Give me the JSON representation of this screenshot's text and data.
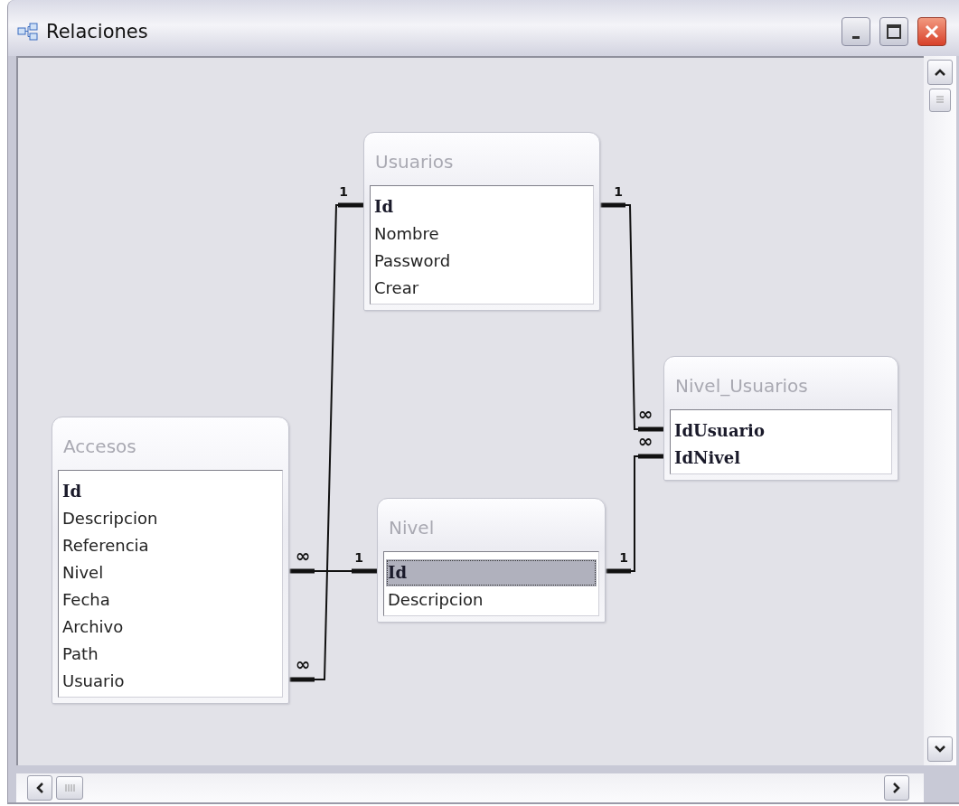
{
  "window": {
    "title": "Relaciones"
  },
  "tables": [
    {
      "name": "Usuarios",
      "fields": [
        {
          "name": "Id",
          "key": true,
          "selected": false
        },
        {
          "name": "Nombre",
          "key": false,
          "selected": false
        },
        {
          "name": "Password",
          "key": false,
          "selected": false
        },
        {
          "name": "Crear",
          "key": false,
          "selected": false
        }
      ]
    },
    {
      "name": "Nivel_Usuarios",
      "fields": [
        {
          "name": "IdUsuario",
          "key": true,
          "selected": false
        },
        {
          "name": "IdNivel",
          "key": true,
          "selected": false
        }
      ]
    },
    {
      "name": "Accesos",
      "fields": [
        {
          "name": "Id",
          "key": true,
          "selected": false
        },
        {
          "name": "Descripcion",
          "key": false,
          "selected": false
        },
        {
          "name": "Referencia",
          "key": false,
          "selected": false
        },
        {
          "name": "Nivel",
          "key": false,
          "selected": false
        },
        {
          "name": "Fecha",
          "key": false,
          "selected": false
        },
        {
          "name": "Archivo",
          "key": false,
          "selected": false
        },
        {
          "name": "Path",
          "key": false,
          "selected": false
        },
        {
          "name": "Usuario",
          "key": false,
          "selected": false
        }
      ]
    },
    {
      "name": "Nivel",
      "fields": [
        {
          "name": "Id",
          "key": true,
          "selected": true
        },
        {
          "name": "Descripcion",
          "key": false,
          "selected": false
        }
      ]
    }
  ],
  "relationships": [
    {
      "one": "1",
      "many": "∞"
    },
    {
      "one": "1",
      "many": "∞"
    },
    {
      "one": "1",
      "many": "∞"
    },
    {
      "one": "1",
      "many": "∞"
    }
  ]
}
